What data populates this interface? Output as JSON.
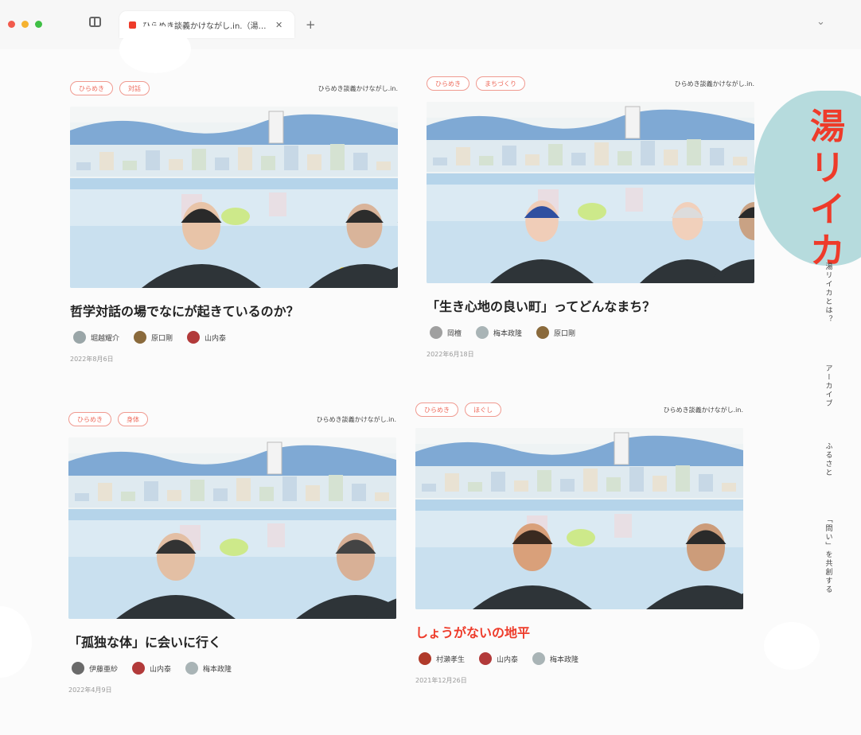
{
  "browser": {
    "tab_title": "ひらめき談義かけながし.in.（湯…",
    "tab_close": "✕",
    "new_tab": "+",
    "traffic_lights": [
      "#f25b4d",
      "#f5b230",
      "#3fbf45"
    ],
    "chevron": "⌄"
  },
  "site": {
    "logo": "湯リイカ",
    "nav": [
      "湯リイカとは？",
      "アーカイブ",
      "ふるさと",
      "「問い」を共創する"
    ],
    "accent": "#ee3b2a"
  },
  "cards": [
    {
      "tags": [
        "ひらめき",
        "対話"
      ],
      "series": "ひらめき談義かけながし.in.",
      "title": "哲学対話の場でなにが起きているのか？",
      "title_color": "#222222",
      "people": [
        {
          "name": "堀越耀介",
          "color": "#9aa6a8"
        },
        {
          "name": "原口剛",
          "color": "#8a6a3c"
        },
        {
          "name": "山内泰",
          "color": "#b23a3a"
        }
      ],
      "date": "2022年8月6日"
    },
    {
      "tags": [
        "ひらめき",
        "まちづくり"
      ],
      "series": "ひらめき談義かけながし.in.",
      "title": "「生き心地の良い町」ってどんなまち？",
      "title_color": "#222222",
      "people": [
        {
          "name": "岡檀",
          "color": "#a0a0a0"
        },
        {
          "name": "梅本政隆",
          "color": "#a9b4b6"
        },
        {
          "name": "原口剛",
          "color": "#8a6a3c"
        }
      ],
      "date": "2022年6月18日"
    },
    {
      "tags": [
        "ひらめき",
        "身体"
      ],
      "series": "ひらめき談義かけながし.in.",
      "title": "「孤独な体」に会いに行く",
      "title_color": "#222222",
      "people": [
        {
          "name": "伊藤亜紗",
          "color": "#6a6a6a"
        },
        {
          "name": "山内泰",
          "color": "#b23a3a"
        },
        {
          "name": "梅本政隆",
          "color": "#a9b4b6"
        }
      ],
      "date": "2022年4月9日"
    },
    {
      "tags": [
        "ひらめき",
        "ほぐし"
      ],
      "series": "ひらめき談義かけながし.in.",
      "title": "しょうがないの地平",
      "title_color": "#ee3b2a",
      "people": [
        {
          "name": "村瀨孝生",
          "color": "#b03a2a"
        },
        {
          "name": "山内泰",
          "color": "#b23a3a"
        },
        {
          "name": "梅本政隆",
          "color": "#a9b4b6"
        }
      ],
      "date": "2021年12月26日"
    }
  ]
}
